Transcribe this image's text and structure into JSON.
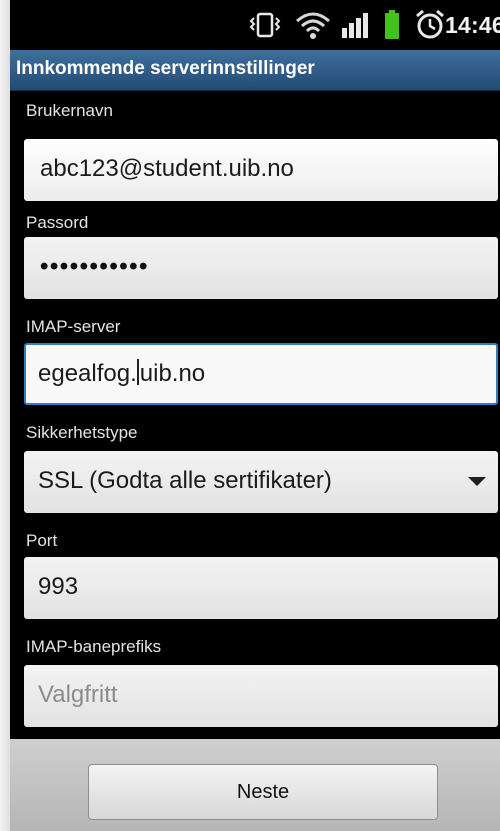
{
  "status_bar": {
    "time": "14:46",
    "icons": [
      "vibrate-icon",
      "wifi-icon",
      "signal-icon",
      "battery-icon",
      "alarm-icon"
    ],
    "battery_color": "#44c21c"
  },
  "title_bar": {
    "title": "Innkommende serverinnstillinger"
  },
  "form": {
    "username": {
      "label": "Brukernavn",
      "value": "abc123@student.uib.no"
    },
    "password": {
      "label": "Passord",
      "value": "•••••••••••"
    },
    "imap_server": {
      "label": "IMAP-server",
      "value_before_cursor": "egealfog.",
      "value_after_cursor": "uib.no"
    },
    "security_type": {
      "label": "Sikkerhetstype",
      "value": "SSL (Godta alle sertifikater)"
    },
    "port": {
      "label": "Port",
      "value": "993"
    },
    "path_prefix": {
      "label": "IMAP-baneprefiks",
      "placeholder": "Valgfritt"
    }
  },
  "footer": {
    "next_label": "Neste"
  },
  "colors": {
    "title_bar": "#2f5b87",
    "focus_border": "#2f7fc5",
    "background": "#000000"
  }
}
